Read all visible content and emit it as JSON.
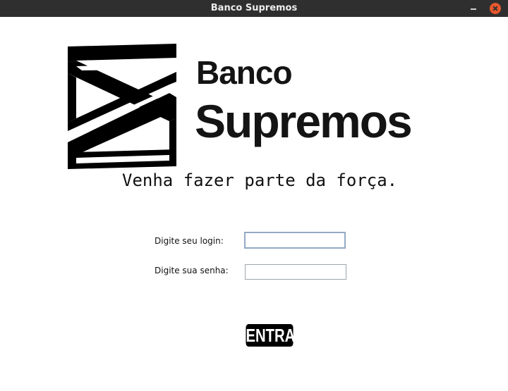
{
  "window": {
    "title": "Banco Supremos"
  },
  "brand": {
    "line1": "Banco",
    "line2": "Supremos"
  },
  "tagline": "Venha fazer parte da força.",
  "form": {
    "login_label": "Digite seu login:",
    "login_value": "",
    "password_label": "Digite sua senha:",
    "password_value": "",
    "submit_label": "ENTRAR"
  },
  "colors": {
    "titlebar": "#2f2f2f",
    "close_button": "#e8572d",
    "brand": "#141414",
    "button": "#000000"
  }
}
